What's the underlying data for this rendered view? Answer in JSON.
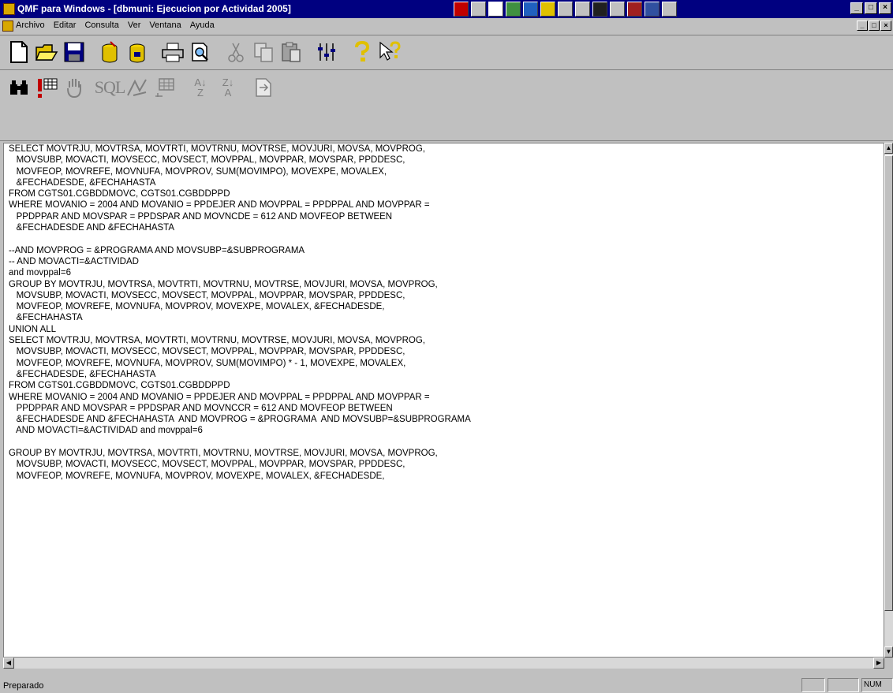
{
  "window": {
    "title": "QMF para Windows - [dbmuni: Ejecucion por Actividad 2005]",
    "controls": [
      "_",
      "□",
      "×"
    ]
  },
  "menubar": {
    "items": [
      "Archivo",
      "Editar",
      "Consulta",
      "Ver",
      "Ventana",
      "Ayuda"
    ]
  },
  "toolbar1": {
    "buttons": [
      "new-file-icon",
      "open-folder-icon",
      "save-disk-icon",
      "db-open-icon",
      "db-save-icon",
      "print-icon",
      "print-preview-icon",
      "cut-icon",
      "copy-icon",
      "paste-icon",
      "options-sliders-icon",
      "help-icon",
      "context-help-icon"
    ]
  },
  "toolbar2": {
    "buttons": [
      "find-binoculars-icon",
      "run-query-icon",
      "stop-hand-icon",
      "sql-icon",
      "draw-icon",
      "grid-form-icon",
      "sort-ascending-icon",
      "sort-descending-icon",
      "export-icon"
    ],
    "sql_label": "SQL",
    "sort_asc_label": "A↓Z",
    "sort_desc_label": "Z↓A"
  },
  "query": {
    "lines": [
      "SELECT MOVTRJU, MOVTRSA, MOVTRTI, MOVTRNU, MOVTRSE, MOVJURI, MOVSA, MOVPROG,",
      "   MOVSUBP, MOVACTI, MOVSECC, MOVSECT, MOVPPAL, MOVPPAR, MOVSPAR, PPDDESC,",
      "   MOVFEOP, MOVREFE, MOVNUFA, MOVPROV, SUM(MOVIMPO), MOVEXPE, MOVALEX,",
      "   &FECHADESDE, &FECHAHASTA",
      "FROM CGTS01.CGBDDMOVC, CGTS01.CGBDDPPD",
      "WHERE MOVANIO = 2004 AND MOVANIO = PPDEJER AND MOVPPAL = PPDPPAL AND MOVPPAR =",
      "   PPDPPAR AND MOVSPAR = PPDSPAR AND MOVNCDE = 612 AND MOVFEOP BETWEEN",
      "   &FECHADESDE AND &FECHAHASTA",
      "",
      "--AND MOVPROG = &PROGRAMA AND MOVSUBP=&SUBPROGRAMA",
      "-- AND MOVACTI=&ACTIVIDAD",
      "and movppal=6",
      "GROUP BY MOVTRJU, MOVTRSA, MOVTRTI, MOVTRNU, MOVTRSE, MOVJURI, MOVSA, MOVPROG,",
      "   MOVSUBP, MOVACTI, MOVSECC, MOVSECT, MOVPPAL, MOVPPAR, MOVSPAR, PPDDESC,",
      "   MOVFEOP, MOVREFE, MOVNUFA, MOVPROV, MOVEXPE, MOVALEX, &FECHADESDE,",
      "   &FECHAHASTA",
      "UNION ALL",
      "SELECT MOVTRJU, MOVTRSA, MOVTRTI, MOVTRNU, MOVTRSE, MOVJURI, MOVSA, MOVPROG,",
      "   MOVSUBP, MOVACTI, MOVSECC, MOVSECT, MOVPPAL, MOVPPAR, MOVSPAR, PPDDESC,",
      "   MOVFEOP, MOVREFE, MOVNUFA, MOVPROV, SUM(MOVIMPO) * - 1, MOVEXPE, MOVALEX,",
      "   &FECHADESDE, &FECHAHASTA",
      "FROM CGTS01.CGBDDMOVC, CGTS01.CGBDDPPD",
      "WHERE MOVANIO = 2004 AND MOVANIO = PPDEJER AND MOVPPAL = PPDPPAL AND MOVPPAR =",
      "   PPDPPAR AND MOVSPAR = PPDSPAR AND MOVNCCR = 612 AND MOVFEOP BETWEEN",
      "   &FECHADESDE AND &FECHAHASTA  AND MOVPROG = &PROGRAMA  AND MOVSUBP=&SUBPROGRAMA",
      "   AND MOVACTI=&ACTIVIDAD and movppal=6",
      "",
      "GROUP BY MOVTRJU, MOVTRSA, MOVTRTI, MOVTRNU, MOVTRSE, MOVJURI, MOVSA, MOVPROG,",
      "   MOVSUBP, MOVACTI, MOVSECC, MOVSECT, MOVPPAL, MOVPPAR, MOVSPAR, PPDDESC,",
      "   MOVFEOP, MOVREFE, MOVNUFA, MOVPROV, MOVEXPE, MOVALEX, &FECHADESDE,"
    ]
  },
  "statusbar": {
    "text": "Preparado",
    "indicator": "NUM"
  },
  "colors": {
    "titlebar": "#000080",
    "chrome": "#c0c0c0",
    "editor_bg": "#ffffff"
  }
}
